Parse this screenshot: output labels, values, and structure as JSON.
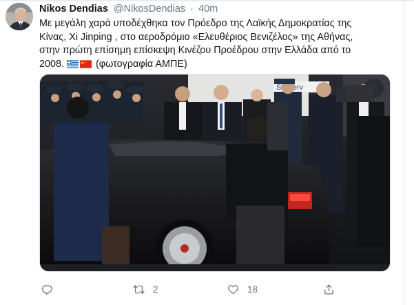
{
  "tweet": {
    "author_name": "Nikos Dendias",
    "handle": "@NikosDendias",
    "separator": "·",
    "time": "40m",
    "text_lines": [
      "Με μεγάλη χαρά υποδέχθηκα τον Πρόεδρο της Λαϊκής Δημοκρατίας της",
      "Κίνας, Xi Jinping , στο αεροδρόμιο «Ελευθέριος Βενιζέλος» της Αθήνας,",
      "στην πρώτη επίσημη επίσκεψη Κινέζου Προέδρου στην Ελλάδα από το",
      "2008."
    ],
    "flags": [
      "greece-flag-icon",
      "china-flag-icon"
    ],
    "photo_credit": "(φωτογραφία ΑΜΠΕ)",
    "photo_sign_text": "Skyserv"
  },
  "actions": {
    "reply_count": "",
    "retweet_count": "2",
    "like_count": "18",
    "share_count": ""
  },
  "colors": {
    "text": "#14171a",
    "secondary": "#657786",
    "border": "#e6ecf0",
    "greece_blue": "#0d5eaf",
    "china_red": "#de2910",
    "china_yellow": "#ffde00"
  }
}
